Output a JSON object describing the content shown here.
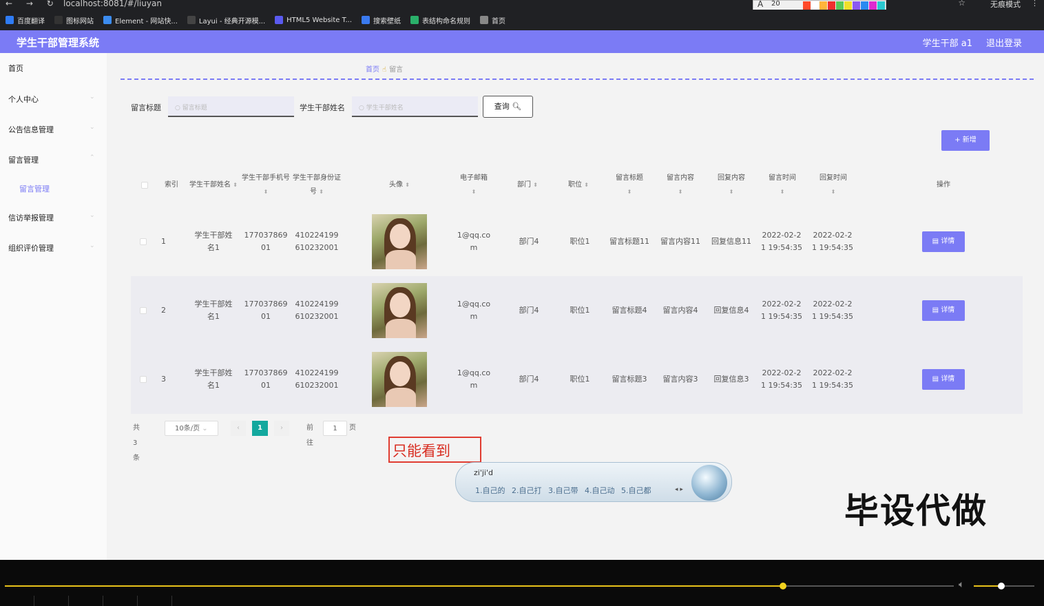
{
  "browser": {
    "url": "localhost:8081/#/liuyan",
    "incognito": "无痕模式",
    "palette_font": "A",
    "palette_size": "20",
    "palette_colors": [
      "#ff4a2a",
      "#ffffff",
      "#ffb43a",
      "#f02e2e",
      "#5ac85a",
      "#f0e02a",
      "#8a5af0",
      "#2a8af0",
      "#e02ad0",
      "#2ac8d0"
    ]
  },
  "bookmarks": [
    {
      "label": "百度翻译",
      "color": "#2f7cf6"
    },
    {
      "label": "图标网站",
      "color": "#333333"
    },
    {
      "label": "Element - 网站快...",
      "color": "#3c8cf0"
    },
    {
      "label": "Layui - 经典开源模...",
      "color": "#444444"
    },
    {
      "label": "HTML5 Website T...",
      "color": "#5a5af0"
    },
    {
      "label": "搜索壁纸",
      "color": "#3a7af0"
    },
    {
      "label": "表结构命名规则",
      "color": "#2ab06a"
    },
    {
      "label": "首页",
      "color": "#888888"
    }
  ],
  "header": {
    "title": "学生干部管理系统",
    "user": "学生干部 a1",
    "logout": "退出登录"
  },
  "sidebar": {
    "items": [
      "首页",
      "个人中心",
      "公告信息管理",
      "留言管理",
      "留言管理",
      "信访举报管理",
      "组织评价管理"
    ]
  },
  "breadcrumb": {
    "home": "首页",
    "sep": "☝",
    "current": "留言"
  },
  "search": {
    "title_label": "留言标题",
    "title_placeholder": "留言标题",
    "name_label": "学生干部姓名",
    "name_placeholder": "学生干部姓名",
    "query_button": "查询",
    "add_button": "+ 新增"
  },
  "table": {
    "headers": {
      "index": "索引",
      "name": "学生干部姓名",
      "phone": "学生干部手机号",
      "idcard": "学生干部身份证号",
      "avatar": "头像",
      "email": "电子邮箱",
      "dept": "部门",
      "post": "职位",
      "msg_title": "留言标题",
      "msg_content": "留言内容",
      "reply": "回复内容",
      "msg_time": "留言时间",
      "reply_time": "回复时间",
      "actions": "操作"
    },
    "rows": [
      {
        "index": "1",
        "name": "学生干部姓名1",
        "phone": "17703786901",
        "idcard": "410224199610232001",
        "email": "1@qq.com",
        "dept": "部门4",
        "post": "职位1",
        "msg_title": "留言标题11",
        "msg_content": "留言内容11",
        "reply": "回复信息11",
        "msg_time": "2022-02-21 19:54:35",
        "reply_time": "2022-02-21 19:54:35",
        "action": "详情"
      },
      {
        "index": "2",
        "name": "学生干部姓名1",
        "phone": "17703786901",
        "idcard": "410224199610232001",
        "email": "1@qq.com",
        "dept": "部门4",
        "post": "职位1",
        "msg_title": "留言标题4",
        "msg_content": "留言内容4",
        "reply": "回复信息4",
        "msg_time": "2022-02-21 19:54:35",
        "reply_time": "2022-02-21 19:54:35",
        "action": "详情"
      },
      {
        "index": "3",
        "name": "学生干部姓名1",
        "phone": "17703786901",
        "idcard": "410224199610232001",
        "email": "1@qq.com",
        "dept": "部门4",
        "post": "职位1",
        "msg_title": "留言标题3",
        "msg_content": "留言内容3",
        "reply": "回复信息3",
        "msg_time": "2022-02-21 19:54:35",
        "reply_time": "2022-02-21 19:54:35",
        "action": "详情"
      }
    ]
  },
  "pagination": {
    "total": "共 3 条",
    "page_size": "10条/页",
    "current_page": "1",
    "goto_label": "前往",
    "goto_value": "1",
    "page_suffix": "页"
  },
  "annotation": "只能看到",
  "ime": {
    "typed": "zi'ji'd",
    "candidates": "1.自己的 2.自己打 3.自己带 4.自己动 5.自己都",
    "arrows": "◂ ▸"
  },
  "watermark": "毕设代做",
  "player": {
    "progress": 0.82,
    "volume": 0.45
  }
}
